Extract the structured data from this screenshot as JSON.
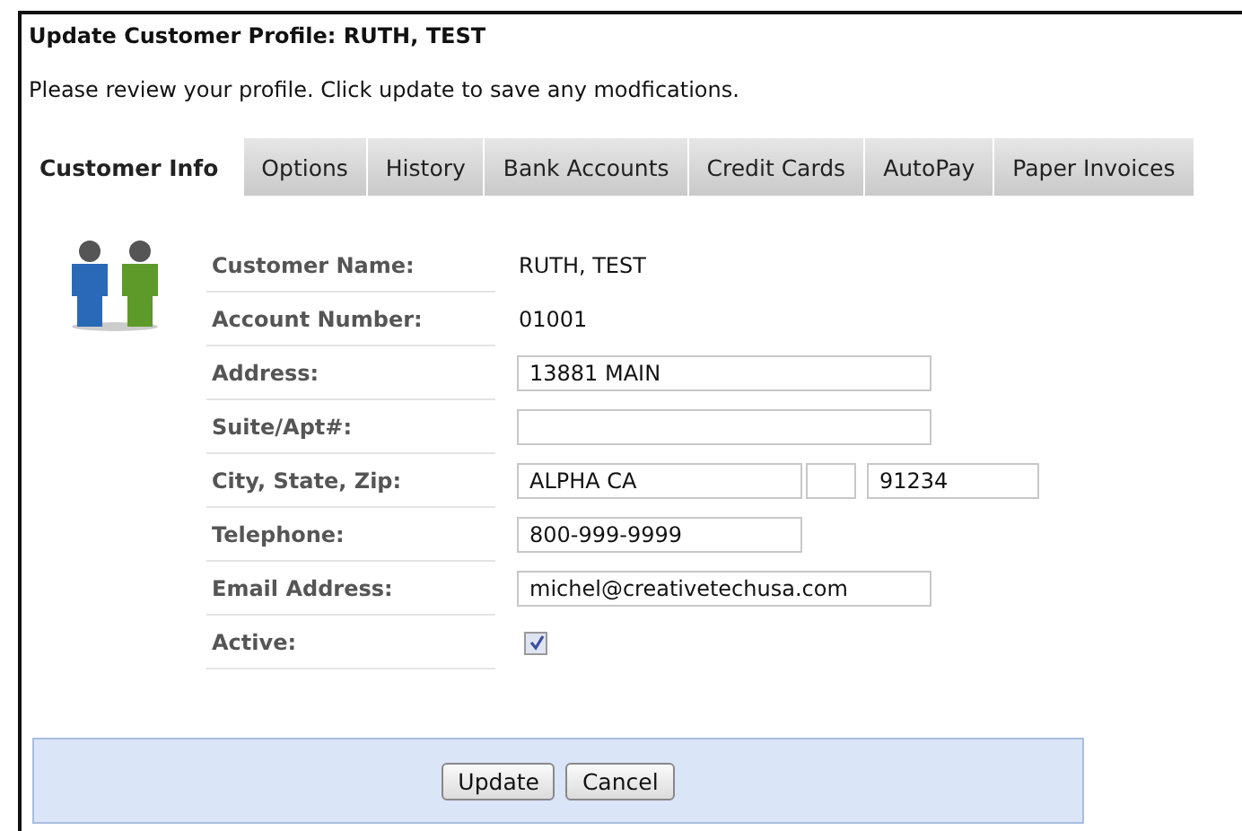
{
  "title": "Update Customer Profile: RUTH, TEST",
  "description": "Please review your profile. Click update to save any modfications.",
  "tabs": [
    {
      "label": "Customer Info",
      "selected": true
    },
    {
      "label": "Options",
      "selected": false
    },
    {
      "label": "History",
      "selected": false
    },
    {
      "label": "Bank Accounts",
      "selected": false
    },
    {
      "label": "Credit Cards",
      "selected": false
    },
    {
      "label": "AutoPay",
      "selected": false
    },
    {
      "label": "Paper Invoices",
      "selected": false
    }
  ],
  "fields": [
    {
      "label": "Customer Name:",
      "kind": "text",
      "value": "RUTH, TEST"
    },
    {
      "label": "Account Number:",
      "kind": "text",
      "value": "01001"
    },
    {
      "label": "Address:",
      "kind": "input",
      "value": "13881 MAIN"
    },
    {
      "label": "Suite/Apt#:",
      "kind": "input"
    },
    {
      "label": "City, State, Zip:",
      "kind": "citystatezip",
      "city": "ALPHA CA",
      "zip": "91234"
    },
    {
      "label": "Telephone:",
      "kind": "short_input",
      "value": "800-999-9999"
    },
    {
      "label": "Email Address:",
      "kind": "input",
      "value": "michel@creativetechusa.com"
    },
    {
      "label": "Active:",
      "kind": "checkbox",
      "checked": true
    }
  ],
  "buttons": [
    "Update",
    "Cancel"
  ]
}
